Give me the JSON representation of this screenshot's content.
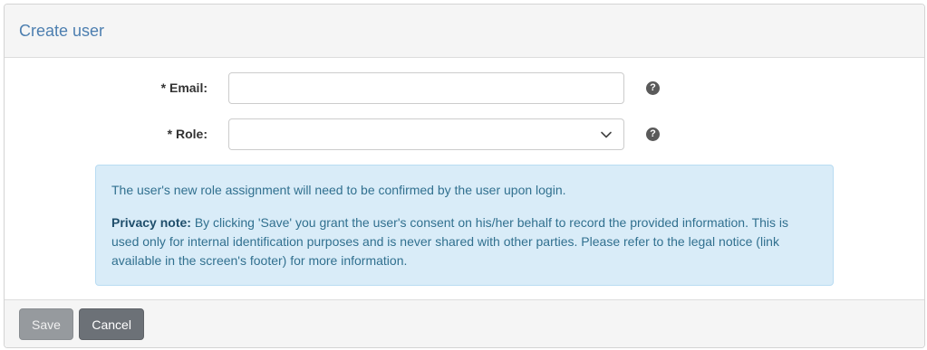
{
  "header": {
    "title": "Create user"
  },
  "form": {
    "email": {
      "label": "* Email:",
      "value": "",
      "placeholder": ""
    },
    "role": {
      "label": "* Role:",
      "selected": ""
    },
    "help_icon_glyph": "?"
  },
  "notice": {
    "line1": "The user's new role assignment will need to be confirmed by the user upon login.",
    "privacy_label": "Privacy note:",
    "privacy_text": " By clicking 'Save' you grant the user's consent on his/her behalf to record the provided information. This is used only for internal identification purposes and is never shared with other parties. Please refer to the legal notice (link available in the screen's footer) for more information."
  },
  "footer": {
    "save_label": "Save",
    "cancel_label": "Cancel"
  },
  "icons": {
    "help": "question-circle-icon",
    "dropdown": "chevron-down-icon"
  },
  "colors": {
    "title": "#4d7fb0",
    "alert_bg": "#d9ecf8",
    "alert_text": "#31708f",
    "save_btn": "#969a9e",
    "cancel_btn": "#6c7177"
  }
}
